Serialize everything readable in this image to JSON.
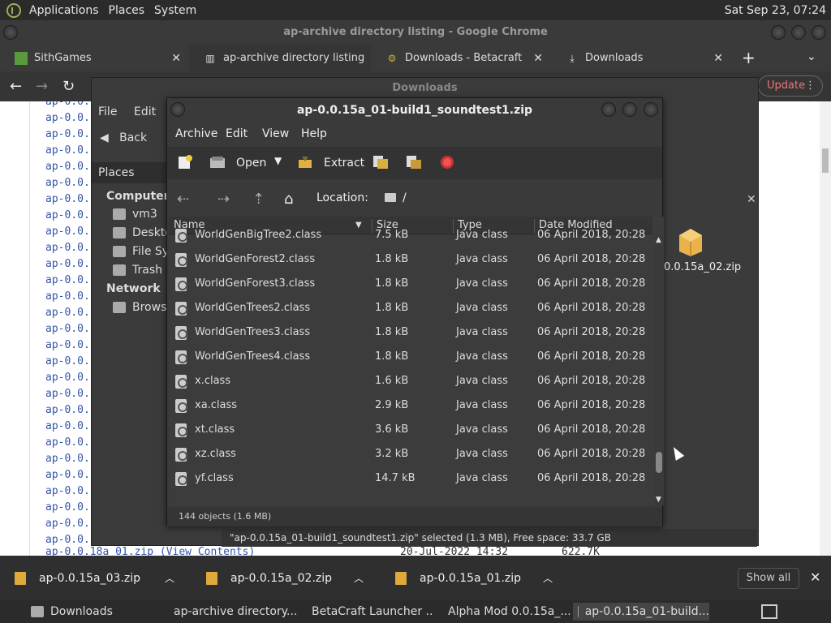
{
  "top_panel": {
    "menus": [
      "Applications",
      "Places",
      "System"
    ],
    "clock": "Sat Sep 23, 07:24"
  },
  "chrome": {
    "window_title": "ap-archive directory listing - Google Chrome",
    "tabs": [
      {
        "label": "SithGames",
        "icon": "grass-block-icon"
      },
      {
        "label": "ap-archive directory listing",
        "icon": "archive-icon"
      },
      {
        "label": "Downloads - Betacraft",
        "icon": "betacraft-icon"
      },
      {
        "label": "Downloads",
        "icon": "download-icon"
      }
    ],
    "update_label": "Update"
  },
  "page": {
    "rows_prefix": "ap-0.0.",
    "last_row": {
      "name": "ap-0.0.18a_01.zip (View Contents)",
      "date": "20-Jul-2022 14:32",
      "size": "622.7K"
    }
  },
  "downloads_window": {
    "title": "Downloads",
    "menus": [
      "File",
      "Edit"
    ],
    "back_label": "Back",
    "places_label": "Places",
    "sidebar": {
      "computer_heading": "Computer",
      "computer_items": [
        "vm3",
        "Deskto",
        "File Sys",
        "Trash"
      ],
      "network_heading": "Network",
      "network_items": [
        "Browse"
      ]
    },
    "visible_file": "0.0.15a_02.zip",
    "status": "\"ap-0.0.15a_01-build1_soundtest1.zip\" selected (1.3 MB), Free space: 33.7 GB"
  },
  "archive_window": {
    "title": "ap-0.0.15a_01-build1_soundtest1.zip",
    "menus": [
      "Archive",
      "Edit",
      "View",
      "Help"
    ],
    "toolbar": {
      "open": "Open",
      "extract": "Extract"
    },
    "location_label": "Location:",
    "location_value": "/",
    "columns": {
      "name": "Name",
      "size": "Size",
      "type": "Type",
      "date": "Date Modified"
    },
    "files": [
      {
        "name": "WorldGenBigTree2.class",
        "size": "7.5 kB",
        "type": "Java class",
        "date": "06 April 2018, 20:28"
      },
      {
        "name": "WorldGenForest2.class",
        "size": "1.8 kB",
        "type": "Java class",
        "date": "06 April 2018, 20:28"
      },
      {
        "name": "WorldGenForest3.class",
        "size": "1.8 kB",
        "type": "Java class",
        "date": "06 April 2018, 20:28"
      },
      {
        "name": "WorldGenTrees2.class",
        "size": "1.8 kB",
        "type": "Java class",
        "date": "06 April 2018, 20:28"
      },
      {
        "name": "WorldGenTrees3.class",
        "size": "1.8 kB",
        "type": "Java class",
        "date": "06 April 2018, 20:28"
      },
      {
        "name": "WorldGenTrees4.class",
        "size": "1.8 kB",
        "type": "Java class",
        "date": "06 April 2018, 20:28"
      },
      {
        "name": "x.class",
        "size": "1.6 kB",
        "type": "Java class",
        "date": "06 April 2018, 20:28"
      },
      {
        "name": "xa.class",
        "size": "2.9 kB",
        "type": "Java class",
        "date": "06 April 2018, 20:28"
      },
      {
        "name": "xt.class",
        "size": "3.6 kB",
        "type": "Java class",
        "date": "06 April 2018, 20:28"
      },
      {
        "name": "xz.class",
        "size": "3.2 kB",
        "type": "Java class",
        "date": "06 April 2018, 20:28"
      },
      {
        "name": "yf.class",
        "size": "14.7 kB",
        "type": "Java class",
        "date": "06 April 2018, 20:28"
      }
    ],
    "status": "144 objects (1.6 MB)"
  },
  "shelf": {
    "items": [
      "ap-0.0.15a_03.zip",
      "ap-0.0.15a_02.zip",
      "ap-0.0.15a_01.zip"
    ],
    "show_all": "Show all"
  },
  "taskbar": {
    "tasks": [
      "Downloads",
      "ap-archive directory...",
      "BetaCraft Launcher ...",
      "Alpha Mod 0.0.15a_...",
      "ap-0.0.15a_01-build..."
    ]
  },
  "colors": {
    "link": "#3355aa",
    "panel": "#2b2b2b",
    "zip": "#e0a93a",
    "update": "#e77777"
  }
}
